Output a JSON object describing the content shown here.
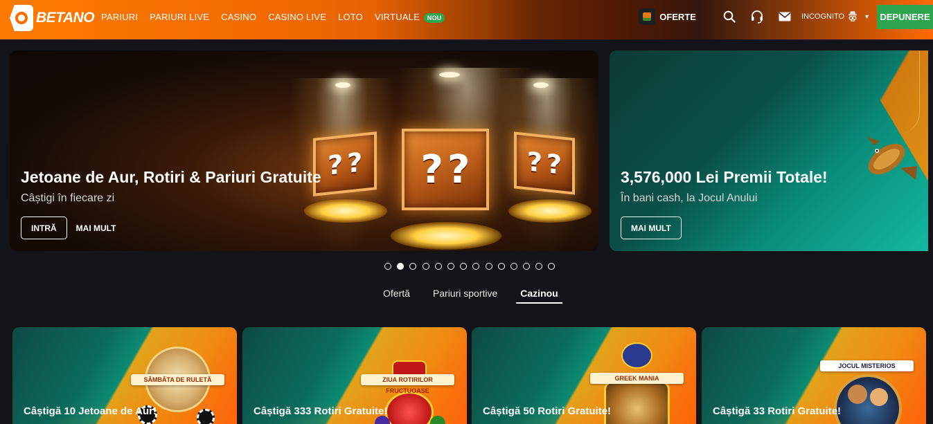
{
  "header": {
    "logo_text": "BETANO",
    "nav": [
      {
        "label": "PARIURI"
      },
      {
        "label": "PARIURI LIVE"
      },
      {
        "label": "CASINO"
      },
      {
        "label": "CASINO LIVE"
      },
      {
        "label": "LOTO"
      },
      {
        "label": "VIRTUALE",
        "badge": "NOU"
      }
    ],
    "offers_label": "OFERTE",
    "username": "INCOGNITO",
    "deposit_label": "DEPUNERE",
    "icons": [
      "search-icon",
      "headset-icon",
      "mail-icon",
      "incognito-hat-icon",
      "caret-down-icon"
    ]
  },
  "banners": [
    {
      "title": "Jetoane de Aur, Rotiri & Pariuri Gratuite",
      "subtitle": "Câștigi în fiecare zi",
      "primary_label": "INTRĂ",
      "secondary_label": "MAI MULT"
    },
    {
      "title": "3,576,000 Lei Premii Totale!",
      "subtitle": "În bani cash, la Jocul Anului",
      "primary_label": "MAI MULT"
    }
  ],
  "carousel": {
    "total": 14,
    "active_index": 1
  },
  "tabs": [
    {
      "label": "Ofertă",
      "active": false
    },
    {
      "label": "Pariuri sportive",
      "active": false
    },
    {
      "label": "Cazinou",
      "active": true
    }
  ],
  "cards": [
    {
      "title": "Câștigă 10 Jetoane de Aur!",
      "ribbon": "SÂMBĂTA DE RULETĂ"
    },
    {
      "title": "Câștigă 333 Rotiri Gratuite!",
      "ribbon": "ZIUA ROTIRILOR FRUCTUOASE"
    },
    {
      "title": "Câștigă 50 Rotiri Gratuite!",
      "ribbon": "GREEK MANIA"
    },
    {
      "title": "Câștigă 33 Rotiri Gratuite!",
      "ribbon": "JOCUL MISTERIOS"
    }
  ],
  "colors": {
    "brand_orange": "#ff6a00",
    "deposit_green": "#2ea44f",
    "background": "#121419"
  }
}
